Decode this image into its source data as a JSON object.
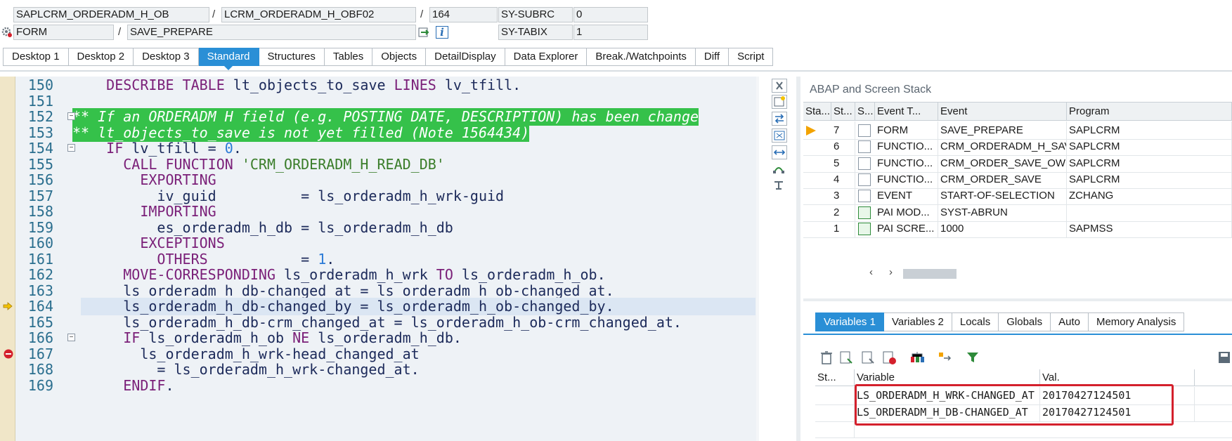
{
  "header": {
    "program": "SAPLCRM_ORDERADM_H_OB",
    "include": "LCRM_ORDERADM_H_OBF02",
    "line": "164",
    "sysvar1_name": "SY-SUBRC",
    "sysvar1_value": "0",
    "event_type": "FORM",
    "event_name": "SAVE_PREPARE",
    "sysvar2_name": "SY-TABIX",
    "sysvar2_value": "1",
    "sep": "/"
  },
  "tabs": [
    "Desktop 1",
    "Desktop 2",
    "Desktop 3",
    "Standard",
    "Structures",
    "Tables",
    "Objects",
    "DetailDisplay",
    "Data Explorer",
    "Break./Watchpoints",
    "Diff",
    "Script"
  ],
  "active_tab": "Standard",
  "code": {
    "lines": [
      {
        "n": "150",
        "t": "    DESCRIBE TABLE lt_objects_to_save LINES lv_tfill."
      },
      {
        "n": "151",
        "t": ""
      },
      {
        "n": "152",
        "t": "** If an ORDERADM_H field (e.g. POSTING_DATE, DESCRIPTION) has been change"
      },
      {
        "n": "153",
        "t": "** lt_objects_to_save is not yet filled (Note 1564434)"
      },
      {
        "n": "154",
        "t": "    IF lv_tfill = 0."
      },
      {
        "n": "155",
        "t": "      CALL FUNCTION 'CRM_ORDERADM_H_READ_DB'"
      },
      {
        "n": "156",
        "t": "        EXPORTING"
      },
      {
        "n": "157",
        "t": "          iv_guid          = ls_orderadm_h_wrk-guid"
      },
      {
        "n": "158",
        "t": "        IMPORTING"
      },
      {
        "n": "159",
        "t": "          es_orderadm_h_db = ls_orderadm_h_db"
      },
      {
        "n": "160",
        "t": "        EXCEPTIONS"
      },
      {
        "n": "161",
        "t": "          OTHERS           = 1."
      },
      {
        "n": "162",
        "t": "      MOVE-CORRESPONDING ls_orderadm_h_wrk TO ls_orderadm_h_ob."
      },
      {
        "n": "163",
        "t": "      ls_orderadm_h_db-changed_at = ls_orderadm_h_ob-changed_at."
      },
      {
        "n": "164",
        "t": "      ls_orderadm_h_db-changed_by = ls_orderadm_h_ob-changed_by."
      },
      {
        "n": "165",
        "t": "      ls_orderadm_h_db-crm_changed_at = ls_orderadm_h_ob-crm_changed_at."
      },
      {
        "n": "166",
        "t": "      IF ls_orderadm_h_ob NE ls_orderadm_h_db."
      },
      {
        "n": "167",
        "t": "        ls_orderadm_h_wrk-head_changed_at"
      },
      {
        "n": "168",
        "t": "          = ls_orderadm_h_wrk-changed_at."
      },
      {
        "n": "169",
        "t": "      ENDIF."
      }
    ]
  },
  "stack": {
    "title": "ABAP and Screen Stack",
    "columns": [
      "Sta...",
      "St...",
      "S...",
      "Event T...",
      "Event",
      "Program"
    ],
    "rows": [
      {
        "level": "7",
        "type": "FORM",
        "event": "SAVE_PREPARE",
        "program": "SAPLCRM",
        "current": true,
        "icon": "abap-icon"
      },
      {
        "level": "6",
        "type": "FUNCTIO...",
        "event": "CRM_ORDERADM_H_SAVE_OB",
        "program": "SAPLCRM",
        "icon": "abap-icon"
      },
      {
        "level": "5",
        "type": "FUNCTIO...",
        "event": "CRM_ORDER_SAVE_OW",
        "program": "SAPLCRM",
        "icon": "abap-icon"
      },
      {
        "level": "4",
        "type": "FUNCTIO...",
        "event": "CRM_ORDER_SAVE",
        "program": "SAPLCRM",
        "icon": "abap-icon"
      },
      {
        "level": "3",
        "type": "EVENT",
        "event": "START-OF-SELECTION",
        "program": "ZCHANG",
        "icon": "abap-icon"
      },
      {
        "level": "2",
        "type": "PAI MOD...",
        "event": "SYST-ABRUN",
        "program": "",
        "icon": "screen-icon"
      },
      {
        "level": "1",
        "type": "PAI SCRE...",
        "event": "1000",
        "program": "SAPMSS",
        "icon": "screen-icon"
      }
    ]
  },
  "var_tabs": [
    "Variables 1",
    "Variables 2",
    "Locals",
    "Globals",
    "Auto",
    "Memory Analysis"
  ],
  "variables": {
    "columns": [
      "St...",
      "Variable",
      "Val."
    ],
    "rows": [
      {
        "name": "LS_ORDERADM_H_WRK-CHANGED_AT",
        "value": "20170427124501"
      },
      {
        "name": "LS_ORDERADM_H_DB-CHANGED_AT",
        "value": "20170427124501"
      }
    ]
  }
}
